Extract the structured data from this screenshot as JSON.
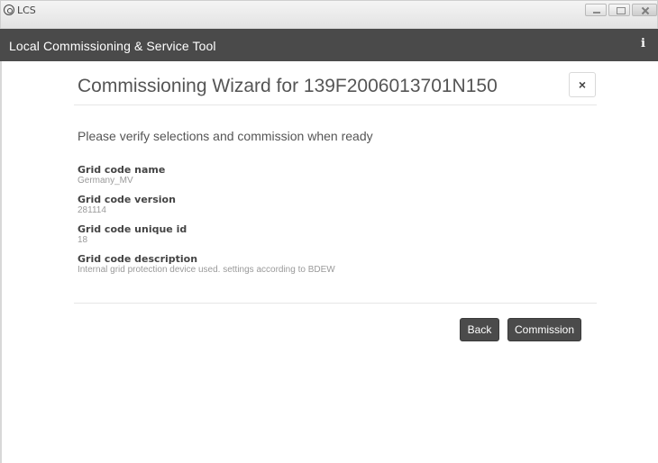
{
  "window": {
    "title": "LCS"
  },
  "header": {
    "app_name": "Local Commissioning & Service Tool",
    "info_glyph": "i"
  },
  "wizard": {
    "title": "Commissioning Wizard for 139F2006013701N150",
    "close_glyph": "×",
    "prompt": "Please verify selections and commission when ready",
    "fields": [
      {
        "label": "Grid code name",
        "value": "Germany_MV"
      },
      {
        "label": "Grid code version",
        "value": "281114"
      },
      {
        "label": "Grid code unique id",
        "value": "18"
      },
      {
        "label": "Grid code description",
        "value": "Internal grid protection device used. settings according to BDEW"
      }
    ],
    "back_label": "Back",
    "commission_label": "Commission"
  },
  "icons": {
    "app": "gear-icon",
    "info": "info-icon",
    "close": "close-icon"
  },
  "colors": {
    "header_bg": "#4a4a4a",
    "button_bg": "#4b4b4b",
    "muted_text": "#9a9a9a"
  }
}
